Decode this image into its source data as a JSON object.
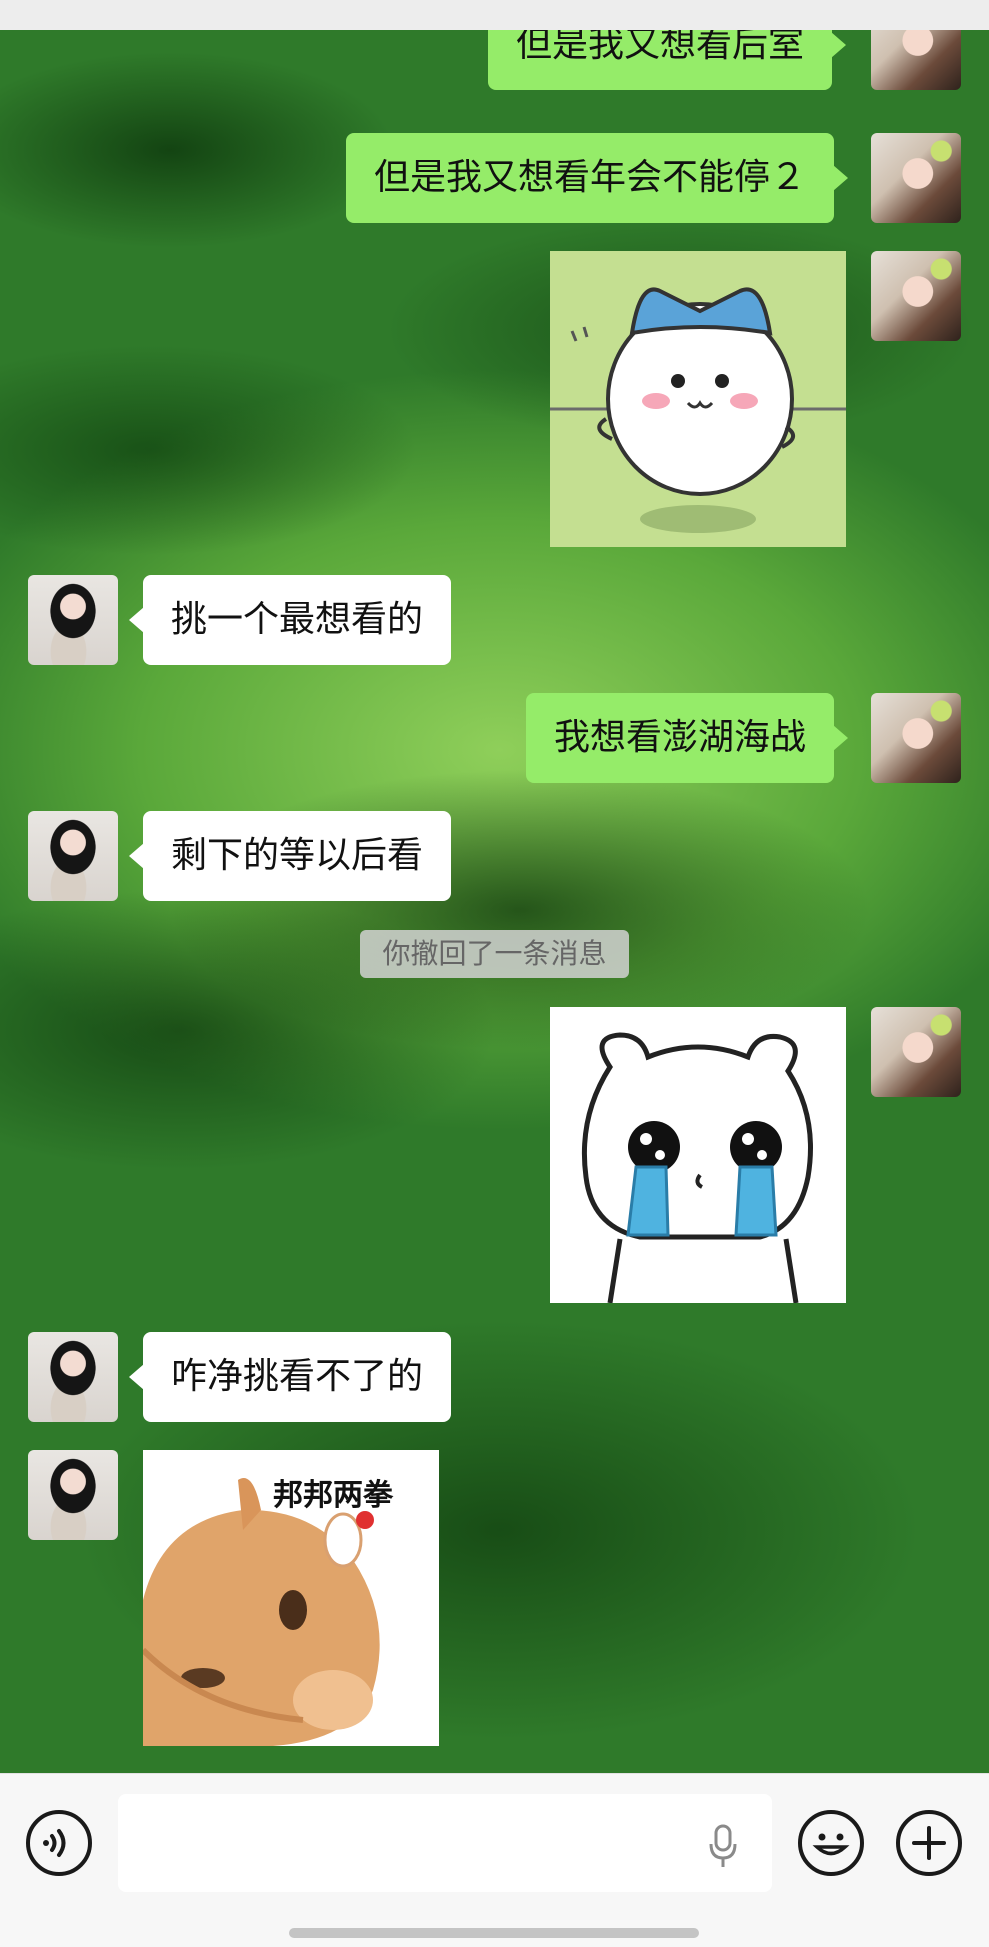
{
  "messages": [
    {
      "sender": "self",
      "type": "text",
      "text": "但是我又想看后室"
    },
    {
      "sender": "self",
      "type": "text",
      "text": "但是我又想看年会不能停２"
    },
    {
      "sender": "self",
      "type": "sticker",
      "sticker": "white-creature-blue-hat"
    },
    {
      "sender": "peer",
      "type": "text",
      "text": "挑一个最想看的"
    },
    {
      "sender": "self",
      "type": "text",
      "text": "我想看澎湖海战"
    },
    {
      "sender": "peer",
      "type": "text",
      "text": "剩下的等以后看"
    },
    {
      "sender": "system",
      "type": "note",
      "text": "你撤回了一条消息"
    },
    {
      "sender": "self",
      "type": "sticker",
      "sticker": "crying-bear"
    },
    {
      "sender": "peer",
      "type": "text",
      "text": "咋净挑看不了的"
    },
    {
      "sender": "peer",
      "type": "sticker",
      "sticker": "punching-cat",
      "caption": "邦邦两拳"
    }
  ],
  "input_bar": {
    "voice_icon": "voice-mode-icon",
    "mic_icon": "microphone-icon",
    "emoji_icon": "emoji-icon",
    "add_icon": "plus-icon"
  },
  "colors": {
    "self_bubble": "#95ec69",
    "peer_bubble": "#ffffff",
    "input_bar": "#f7f7f7"
  }
}
